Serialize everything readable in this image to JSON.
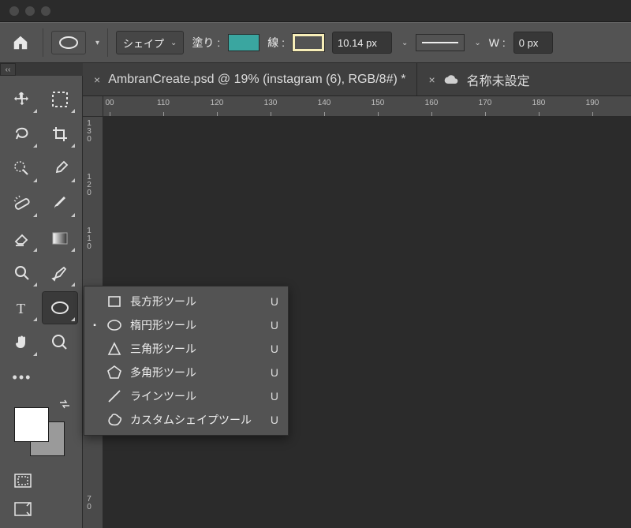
{
  "optionsbar": {
    "mode_label": "シェイプ",
    "fill_label": "塗り :",
    "fill_color": "#3aa6a0",
    "stroke_label": "線 :",
    "stroke_width_value": "10.14 px",
    "width_label": "W :",
    "width_value": "0 px"
  },
  "tabs": {
    "active": "AmbranCreate.psd @ 19% (instagram (6), RGB/8#) *",
    "secondary": "名称未設定"
  },
  "h_ruler_ticks": [
    "00",
    "110",
    "120",
    "130",
    "140",
    "150",
    "160",
    "170",
    "180",
    "190"
  ],
  "v_ruler_ticks": [
    "130",
    "120",
    "110",
    "",
    "",
    "",
    "",
    "70",
    ""
  ],
  "flyout": [
    {
      "name": "長方形ツール",
      "shortcut": "U",
      "icon": "rect",
      "active": false
    },
    {
      "name": "楕円形ツール",
      "shortcut": "U",
      "icon": "ellipse",
      "active": true
    },
    {
      "name": "三角形ツール",
      "shortcut": "U",
      "icon": "triangle",
      "active": false
    },
    {
      "name": "多角形ツール",
      "shortcut": "U",
      "icon": "polygon",
      "active": false
    },
    {
      "name": "ラインツール",
      "shortcut": "U",
      "icon": "line",
      "active": false
    },
    {
      "name": "カスタムシェイプツール",
      "shortcut": "U",
      "icon": "blob",
      "active": false
    }
  ],
  "collapse_glyph": "‹‹"
}
